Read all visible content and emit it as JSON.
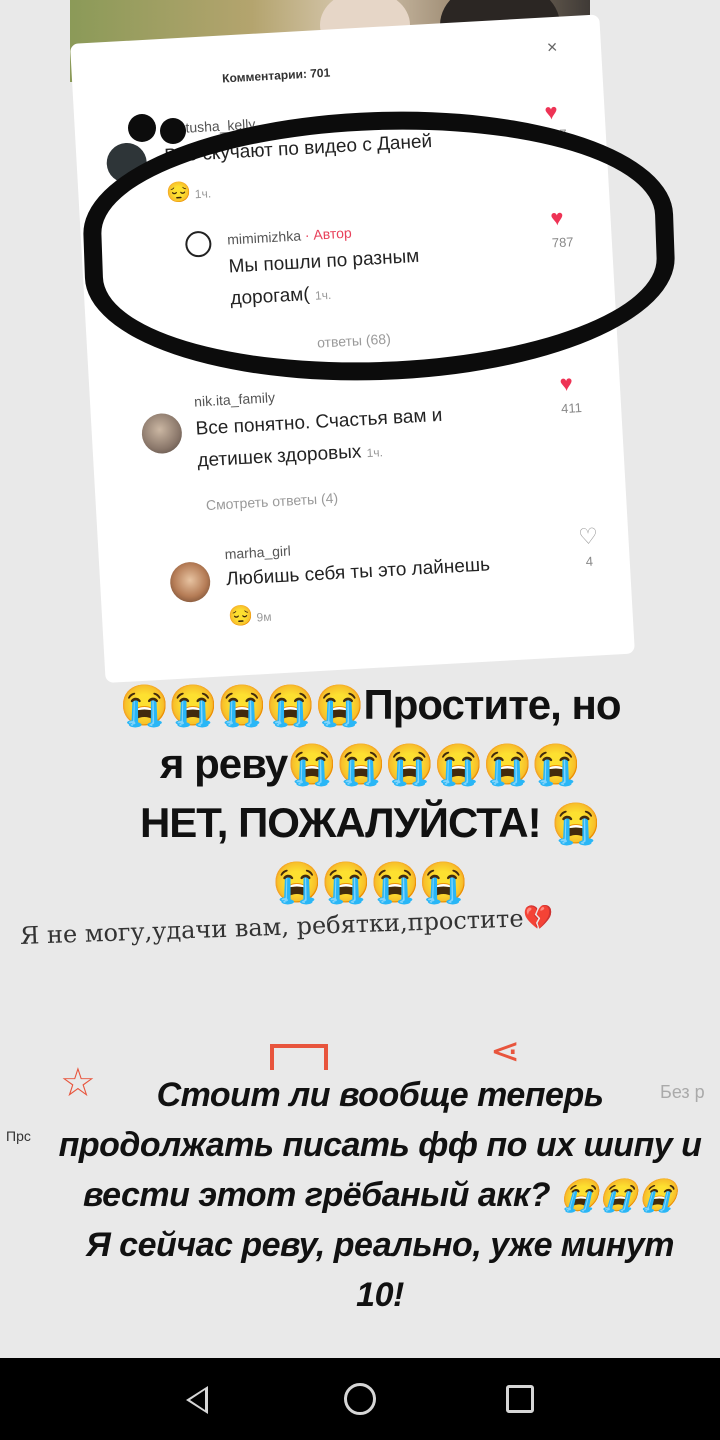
{
  "card": {
    "header": "Комментарии: 701",
    "close": "×"
  },
  "comments": [
    {
      "username": "_katusha_kelly_",
      "text": "Все скучают по видео с Даней",
      "emoji": "😔",
      "time": "1ч.",
      "likes": "1007"
    },
    {
      "username": "mimimizhka",
      "author_tag": "· Автор",
      "text_line1": "Мы пошли по разным",
      "text_line2": "дорогам(",
      "time": "1ч.",
      "likes": "787"
    },
    {
      "replies_partial": "ответы (68)"
    },
    {
      "username": "nik.ita_family",
      "text_line1": "Все понятно. Счастья вам и",
      "text_line2": "детишек здоровых",
      "time": "1ч.",
      "likes": "411",
      "replies": "Смотреть ответы (4)"
    },
    {
      "username": "marha_girl",
      "text": "Любишь себя ты это лайнешь",
      "emoji": "😔",
      "time": "9м",
      "likes": "4"
    }
  ],
  "overlay": {
    "line1_emoji": "😭😭😭😭😭",
    "line1_text": "Простите,  но",
    "line2_text": "я  реву",
    "line2_emoji": "😭😭😭😭😭😭",
    "line3_text": "НЕТ,  ПОЖАЛУЙСТА!  ",
    "line3_emoji": "😭",
    "line4_emoji": "😭😭😭😭"
  },
  "caption": "Я не могу,удачи вам, ребятки,простите💔",
  "question": {
    "line1": "Стоит ли вообще теперь",
    "line2": "продолжать писать фф по их шипу и",
    "line3_text": "вести этот грёбаный акк? ",
    "line3_emoji": "😭😭😭",
    "line4": "Я сейчас реву, реально, уже минут",
    "line5": "10!"
  },
  "background_labels": {
    "bez": "Без р",
    "prefix": "Прс"
  },
  "icons": {
    "star": "☆",
    "share": "⋖",
    "heart_filled": "♥",
    "heart_outline": "♡"
  }
}
